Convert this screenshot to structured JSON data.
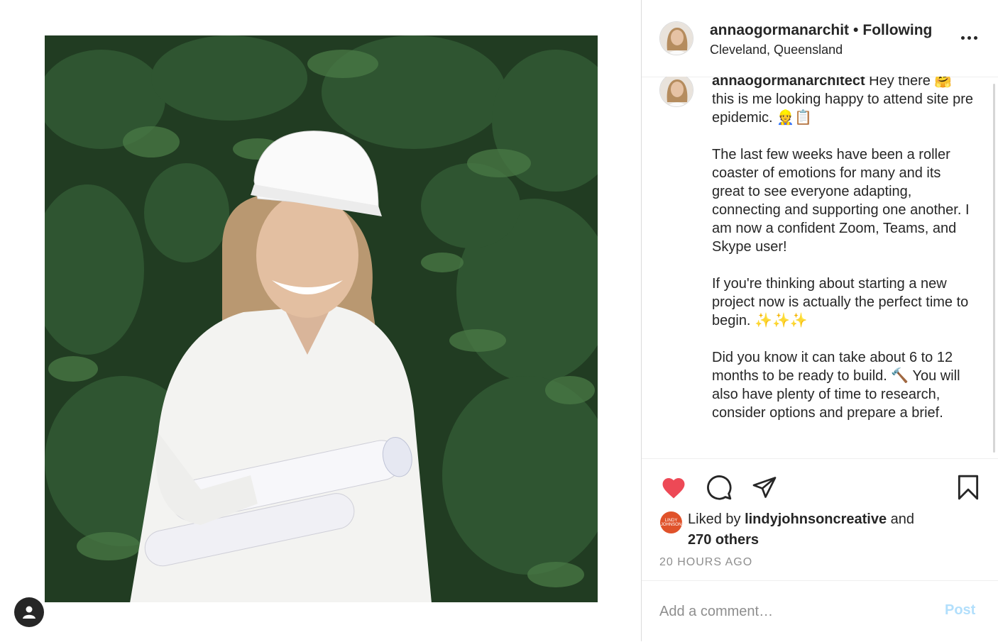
{
  "post": {
    "username": "annaogormanarchit",
    "separator": "•",
    "follow_status": "Following",
    "location": "Cleveland, Queensland",
    "more_icon": "more-options-icon"
  },
  "caption": {
    "author": "annaogormanarchitect",
    "text": " Hey there 🤗 this is me looking happy to attend site pre epidemic. 👷📋\n\nThe last few weeks have been a roller coaster of emotions for many and its great to see everyone adapting, connecting and supporting one another. I am now a confident Zoom, Teams, and Skype user!\n\nIf you're thinking about starting a new project now is actually the perfect time to begin. ✨✨✨\n\nDid you know it can take about 6 to 12 months to be ready to build. 🔨 You will also have plenty of time to research, consider options and prepare a brief."
  },
  "actions": {
    "like_icon": "heart-icon",
    "comment_icon": "comment-icon",
    "share_icon": "share-icon",
    "save_icon": "bookmark-icon",
    "liked": true
  },
  "likes": {
    "prefix": "Liked by ",
    "user": "lindyjohnsoncreative",
    "connector": " and",
    "others": "270 others",
    "avatar_text": "LINDY JOHNSON"
  },
  "timestamp": "20 HOURS AGO",
  "composer": {
    "placeholder": "Add a comment…",
    "post_label": "Post"
  },
  "colors": {
    "like": "#ed4956",
    "post_disabled": "#b2dffc",
    "likes_avatar": "#e0522a"
  }
}
